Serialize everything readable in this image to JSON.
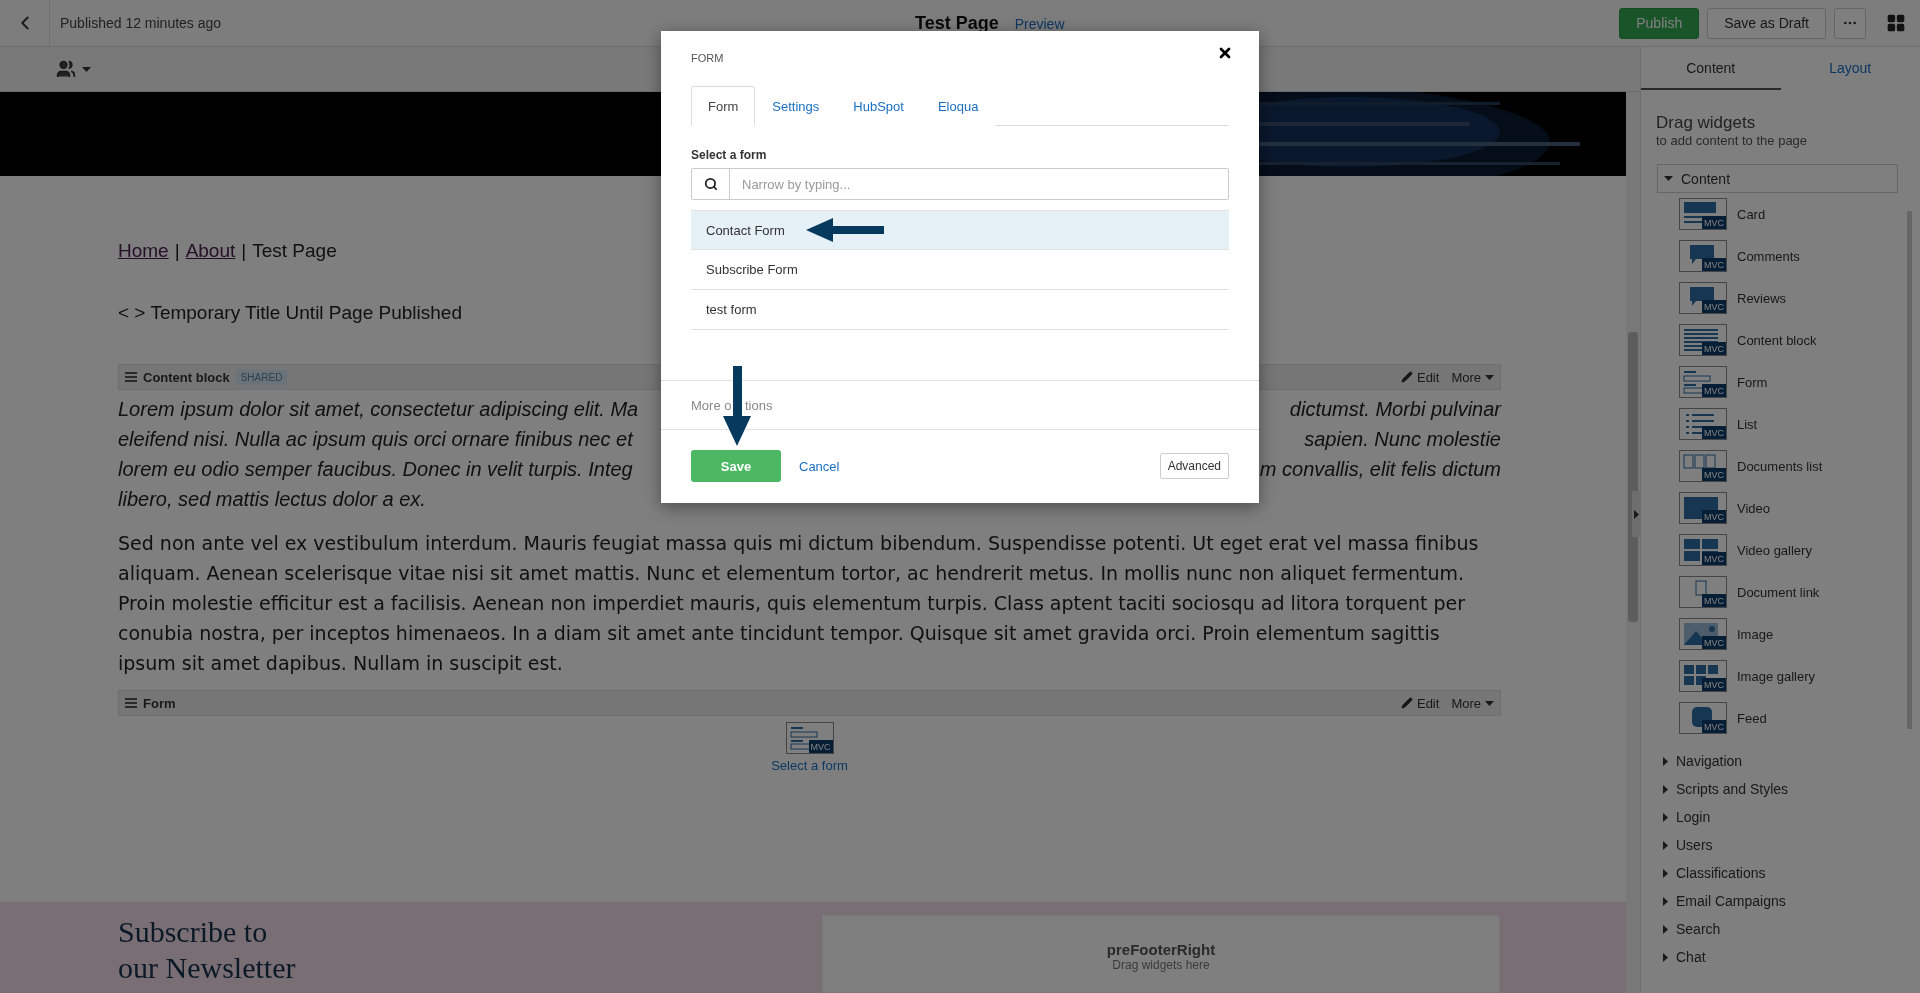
{
  "topbar": {
    "status": "Published 12 minutes ago",
    "title": "Test Page",
    "preview": "Preview",
    "publish": "Publish",
    "save_draft": "Save as Draft"
  },
  "page": {
    "breadcrumb": [
      {
        "kind": "link",
        "text": "Home"
      },
      {
        "kind": "separator",
        "text": "|"
      },
      {
        "kind": "link",
        "text": "About"
      },
      {
        "kind": "separator",
        "text": "|"
      },
      {
        "kind": "current",
        "text": "Test Page"
      }
    ],
    "title": "< > Temporary Title Until Page Published",
    "content_block": {
      "title": "Content block",
      "badge": "SHARED",
      "edit": "Edit",
      "more": "More",
      "italic_lines": [
        {
          "left": "Lorem ipsum dolor sit amet, consectetur adipiscing elit. Ma",
          "right": "dictumst. Morbi pulvinar"
        },
        {
          "left": "eleifend nisi. Nulla ac ipsum quis orci ornare finibus nec et",
          "right": "sapien. Nunc molestie"
        },
        {
          "left": "lorem eu odio semper faucibus. Donec in velit turpis. Integ",
          "right": "m convallis, elit felis dictum"
        },
        {
          "left": "libero, sed mattis lectus dolor a ex."
        }
      ],
      "paragraph": "Sed non ante vel ex vestibulum interdum. Mauris feugiat massa quis mi dictum bibendum. Suspendisse potenti. Ut eget erat vel massa finibus aliquam. Aenean scelerisque vitae nisi sit amet mattis. Nunc et elementum tortor, ac hendrerit metus. In mollis nunc non aliquet fermentum. Proin molestie efficitur est a facilisis. Aenean non imperdiet mauris, quis elementum turpis. Class aptent taciti sociosqu ad litora torquent per conubia nostra, per inceptos himenaeos. In a diam sit amet ante tincidunt tempor. Quisque sit amet gravida orci. Proin elementum sagittis ipsum sit amet dapibus. Nullam in suscipit est."
    },
    "form_widget": {
      "title": "Form",
      "edit": "Edit",
      "more": "More",
      "badge": "MVC",
      "placeholder": "Select a form"
    },
    "footer": {
      "heading": "Subscribe to our Newsletter",
      "zone_title": "preFooterRight",
      "zone_hint": "Drag widgets here"
    }
  },
  "sidebar": {
    "tabs": [
      {
        "label": "Content",
        "selected": true
      },
      {
        "label": "Layout",
        "selected": false
      }
    ],
    "heading": "Drag widgets",
    "subheading": "to add content to the page",
    "groups": [
      {
        "label": "Content",
        "expanded": true,
        "items": [
          {
            "kind": "card",
            "label": "Card",
            "badge": "MVC"
          },
          {
            "kind": "comments",
            "label": "Comments",
            "badge": "MVC"
          },
          {
            "kind": "comments",
            "label": "Reviews",
            "badge": "MVC"
          },
          {
            "kind": "content",
            "label": "Content block",
            "badge": "MVC"
          },
          {
            "kind": "form",
            "label": "Form",
            "badge": "MVC"
          },
          {
            "kind": "list",
            "label": "List",
            "badge": "MVC"
          },
          {
            "kind": "documents",
            "label": "Documents list",
            "badge": "MVC"
          },
          {
            "kind": "video",
            "label": "Video",
            "badge": "MVC"
          },
          {
            "kind": "video-gallery",
            "label": "Video gallery",
            "badge": "MVC"
          },
          {
            "kind": "document",
            "label": "Document link",
            "badge": "MVC"
          },
          {
            "label": "Image",
            "badge": "MVC"
          },
          {
            "kind": "image-gallery",
            "label": "Image gallery",
            "badge": "MVC"
          },
          {
            "kind": "feed",
            "label": "Feed",
            "badge": "MVC"
          }
        ]
      },
      {
        "label": "Navigation",
        "expanded": false
      },
      {
        "label": "Scripts and Styles",
        "expanded": false
      },
      {
        "label": "Login",
        "expanded": false
      },
      {
        "label": "Users",
        "expanded": false
      },
      {
        "label": "Classifications",
        "expanded": false
      },
      {
        "label": "Email Campaigns",
        "expanded": false
      },
      {
        "label": "Search",
        "expanded": false
      },
      {
        "label": "Chat",
        "expanded": false
      }
    ]
  },
  "dialog": {
    "title": "FORM",
    "tabs": [
      {
        "label": "Form",
        "selected": true
      },
      {
        "label": "Settings",
        "selected": false
      },
      {
        "label": "HubSpot",
        "selected": false
      },
      {
        "label": "Eloqua",
        "selected": false
      }
    ],
    "field_label": "Select a form",
    "search": {
      "placeholder": "Narrow by typing..."
    },
    "options": [
      {
        "label": "Contact Form",
        "selected": true
      },
      {
        "label": "Subscribe Form",
        "selected": false
      },
      {
        "label": "test form",
        "selected": false
      }
    ],
    "more_options": {
      "before_arrow": "More o",
      "after_arrow": "tions"
    },
    "save": "Save",
    "cancel": "Cancel",
    "advanced": "Advanced"
  }
}
